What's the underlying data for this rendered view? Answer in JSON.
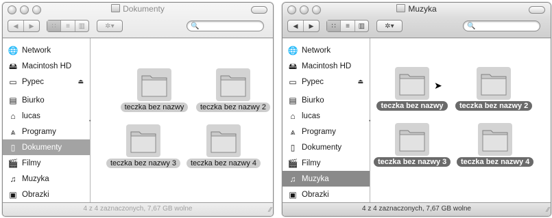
{
  "windows": [
    {
      "title": "Dokumenty",
      "active": false,
      "sidebar": [
        {
          "label": "Network",
          "icon": "network-globe-icon"
        },
        {
          "label": "Macintosh HD",
          "icon": "hard-disk-icon"
        },
        {
          "label": "Pypec",
          "icon": "removable-disk-icon",
          "eject": "⏏"
        },
        {
          "label": "Biurko",
          "icon": "desktop-icon"
        },
        {
          "label": "lucas",
          "icon": "home-icon"
        },
        {
          "label": "Programy",
          "icon": "applications-icon"
        },
        {
          "label": "Dokumenty",
          "icon": "documents-icon",
          "selected": true
        },
        {
          "label": "Filmy",
          "icon": "movies-icon"
        },
        {
          "label": "Muzyka",
          "icon": "music-icon"
        },
        {
          "label": "Obrazki",
          "icon": "pictures-icon"
        }
      ],
      "items": [
        {
          "label": "teczka bez nazwy"
        },
        {
          "label": "teczka bez nazwy 2"
        },
        {
          "label": "teczka bez nazwy 3"
        },
        {
          "label": "teczka bez nazwy 4"
        }
      ],
      "status": "4 z 4 zaznaczonych, 7,67 GB wolne"
    },
    {
      "title": "Muzyka",
      "active": true,
      "sidebar": [
        {
          "label": "Network",
          "icon": "network-globe-icon"
        },
        {
          "label": "Macintosh HD",
          "icon": "hard-disk-icon"
        },
        {
          "label": "Pypec",
          "icon": "removable-disk-icon",
          "eject": "⏏"
        },
        {
          "label": "Biurko",
          "icon": "desktop-icon"
        },
        {
          "label": "lucas",
          "icon": "home-icon"
        },
        {
          "label": "Programy",
          "icon": "applications-icon"
        },
        {
          "label": "Dokumenty",
          "icon": "documents-icon"
        },
        {
          "label": "Filmy",
          "icon": "movies-icon"
        },
        {
          "label": "Muzyka",
          "icon": "music-icon",
          "selected": true
        },
        {
          "label": "Obrazki",
          "icon": "pictures-icon"
        }
      ],
      "items": [
        {
          "label": "teczka bez nazwy"
        },
        {
          "label": "teczka bez nazwy 2"
        },
        {
          "label": "teczka bez nazwy 3"
        },
        {
          "label": "teczka bez nazwy 4"
        }
      ],
      "status": "4 z 4 zaznaczonych, 7,67 GB wolne"
    }
  ],
  "toolbar": {
    "back_icon": "◀",
    "forward_icon": "▶",
    "icon_view": "∷",
    "list_view": "≡",
    "column_view": "▥",
    "action_icon": "✲▾",
    "search_icon": "🔍"
  },
  "resize_grip": "⁄⁄",
  "splitter_glyph": "•",
  "colors": {
    "selection": "#8a8a8a",
    "label_selected_active": "#6a6a6a",
    "label_selected_inactive": "#cdcdcd"
  }
}
